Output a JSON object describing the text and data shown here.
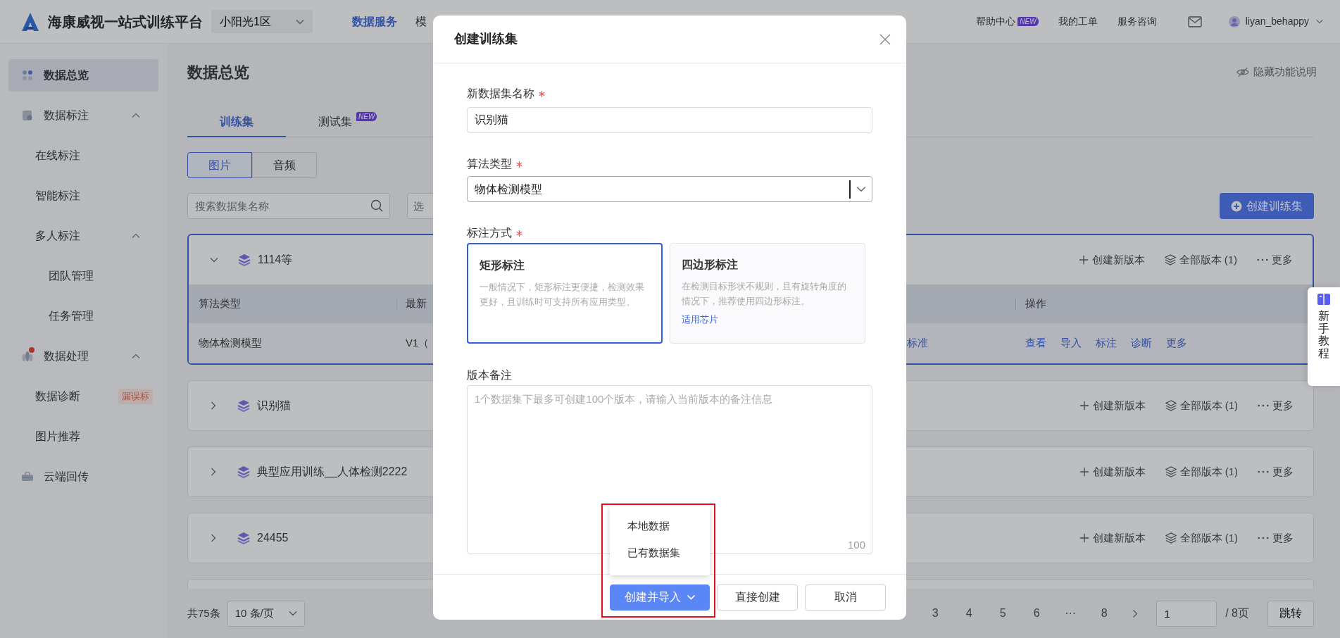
{
  "topbar": {
    "brand": "海康威视一站式训练平台",
    "workspace": "小阳光1区",
    "nav": [
      {
        "label": "数据服务",
        "selected": true
      },
      {
        "label": "模",
        "selected": false
      }
    ],
    "links": [
      {
        "label": "帮助中心",
        "badge": "NEW"
      },
      {
        "label": "我的工单"
      },
      {
        "label": "服务咨询"
      }
    ],
    "user": "liyan_behappy"
  },
  "sidebar": {
    "items": [
      {
        "label": "数据总览",
        "selected": true,
        "dot": false
      },
      {
        "label": "数据标注",
        "selected": false,
        "dot": false,
        "expanded": true,
        "children": [
          {
            "label": "在线标注",
            "selected": false
          },
          {
            "label": "智能标注",
            "selected": false
          },
          {
            "label": "多人标注",
            "selected": false,
            "expanded": true,
            "children": [
              {
                "label": "团队管理",
                "selected": false
              },
              {
                "label": "任务管理",
                "selected": false
              }
            ]
          }
        ]
      },
      {
        "label": "数据处理",
        "selected": false,
        "dot": true,
        "expanded": true,
        "children": [
          {
            "label": "数据诊断",
            "selected": false,
            "badge": "漏误标"
          },
          {
            "label": "图片推荐",
            "selected": false
          }
        ]
      },
      {
        "label": "云端回传",
        "selected": false,
        "dot": false
      }
    ]
  },
  "page": {
    "title": "数据总览",
    "help_toggle": "隐藏功能说明",
    "tabs": [
      {
        "label": "训练集",
        "selected": true
      },
      {
        "label": "测试集",
        "selected": false,
        "badge": "NEW"
      }
    ],
    "media": [
      {
        "label": "图片",
        "selected": true
      },
      {
        "label": "音频",
        "selected": false
      }
    ],
    "search": {
      "placeholder": "搜索数据集名称"
    },
    "filter": {
      "placeholder": "选"
    },
    "create_button": "创建训练集",
    "datasets": [
      {
        "name": "1114等",
        "expanded": true,
        "actions": [
          "创建新版本",
          "全部版本 (1)",
          "更多"
        ],
        "table": {
          "columns": [
            "算法类型",
            "最新",
            "操作"
          ],
          "rows": [
            {
              "cells": [
                "物体检测模型",
                "V1（",
                "标准"
              ],
              "actions": [
                "查看",
                "导入",
                "标注",
                "诊断",
                "更多"
              ]
            }
          ]
        }
      },
      {
        "name": "识别猫",
        "expanded": false,
        "actions": [
          "创建新版本",
          "全部版本 (1)",
          "更多"
        ]
      },
      {
        "name": "典型应用训练__人体检测2222",
        "expanded": false,
        "actions": [
          "创建新版本",
          "全部版本 (1)",
          "更多"
        ]
      },
      {
        "name": "24455",
        "expanded": false,
        "actions": [
          "创建新版本",
          "全部版本 (1)",
          "更多"
        ]
      }
    ],
    "pagination": {
      "total": "共75条",
      "page_size": "10 条/页",
      "pages": [
        "3",
        "4",
        "5",
        "6",
        "···",
        "8"
      ],
      "jump_value": "1",
      "page_count": "/ 8页",
      "jump_button": "跳转"
    }
  },
  "guide_tab": "新手教程",
  "modal": {
    "title": "创建训练集",
    "name_field": {
      "label": "新数据集名称",
      "required": true,
      "value": "识别猫"
    },
    "algorithm_field": {
      "label": "算法类型",
      "required": true,
      "value": "物体检测模型"
    },
    "annotation_field": {
      "label": "标注方式",
      "required": true,
      "options": [
        {
          "title": "矩形标注",
          "description": "一般情况下，矩形标注更便捷，检测效果更好，且训练时可支持所有应用类型。",
          "selected": true
        },
        {
          "title": "四边形标注",
          "description": "在检测目标形状不规则，且有旋转角度的情况下，推荐使用四边形标注。",
          "link": "适用芯片",
          "selected": false
        }
      ]
    },
    "notes_field": {
      "label": "版本备注",
      "required": false,
      "placeholder": "1个数据集下最多可创建100个版本，请输入当前版本的备注信息",
      "counter": "100"
    },
    "buttons": [
      {
        "label": "创建并导入",
        "kind": "primary-dropdown"
      },
      {
        "label": "直接创建",
        "kind": "default"
      },
      {
        "label": "取消",
        "kind": "default"
      }
    ],
    "dropdown_menu": [
      "本地数据",
      "已有数据集"
    ]
  }
}
